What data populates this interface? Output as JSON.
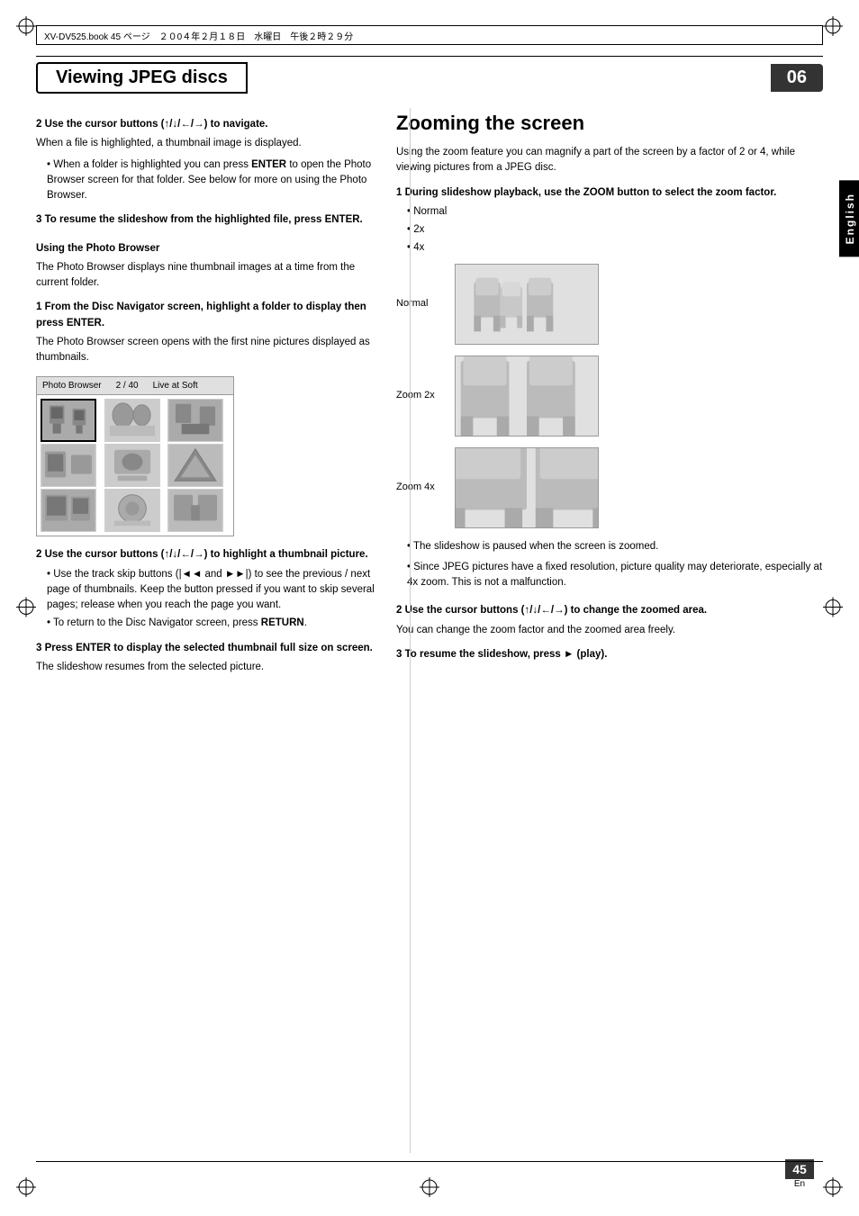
{
  "page": {
    "title": "Viewing JPEG discs",
    "number": "06",
    "bottom_page": "45",
    "bottom_lang": "En",
    "header_japanese": "XV-DV525.book  45 ページ　２０0４年２月１８日　水曜日　午後２時２９分"
  },
  "english_tab": "English",
  "left_column": {
    "step2_nav_heading": "2   Use the cursor buttons (↑/↓/←/→) to navigate.",
    "step2_nav_body": "When a file is highlighted, a thumbnail image is displayed.",
    "step2_nav_bullet1": "When a folder is highlighted you can press ENTER to open the Photo Browser screen for that folder. See below for more on using the Photo Browser.",
    "step3_resume_heading": "3   To resume the slideshow from the highlighted file, press ENTER.",
    "using_photo_browser_heading": "Using the Photo Browser",
    "using_photo_browser_body": "The Photo Browser displays nine thumbnail images at a time from the current folder.",
    "step1_disc_nav_heading": "1   From the Disc Navigator screen, highlight a folder to display then press ENTER.",
    "step1_disc_nav_body": "The Photo Browser screen opens with the first nine pictures displayed as thumbnails.",
    "photo_browser_header_label": "Photo Browser",
    "photo_browser_header_count": "2 / 40",
    "photo_browser_header_mode": "Live at Soft",
    "step2_highlight_heading": "2   Use the cursor buttons (↑/↓/←/→) to highlight a thumbnail picture.",
    "step2_highlight_bullet1": "Use the track skip buttons (|◄◄ and ►►|) to see the previous / next page of thumbnails. Keep the button pressed if you want to skip several pages; release when you reach the page you want.",
    "step2_highlight_bullet2": "To return to the Disc Navigator screen, press RETURN.",
    "step3_press_enter_heading": "3   Press ENTER to display the selected thumbnail full size on screen.",
    "step3_press_enter_body": "The slideshow resumes from the selected picture."
  },
  "right_column": {
    "zooming_heading": "Zooming the screen",
    "zooming_intro": "Using the zoom feature you can magnify a part of the screen by a factor of 2 or 4, while viewing pictures from a JPEG disc.",
    "step1_zoom_heading": "1   During slideshow playback, use the ZOOM button to select the zoom factor.",
    "zoom_bullet_normal": "Normal",
    "zoom_bullet_2x": "2x",
    "zoom_bullet_4x": "4x",
    "zoom_label_normal": "Normal",
    "zoom_label_2x": "Zoom 2x",
    "zoom_label_4x": "Zoom 4x",
    "bullet_paused": "The slideshow is paused when the screen is zoomed.",
    "bullet_quality": "Since JPEG pictures have a fixed resolution, picture quality may deteriorate, especially at 4x zoom. This is not a malfunction.",
    "step2_cursor_heading": "2   Use the cursor buttons (↑/↓/←/→) to change the zoomed area.",
    "step2_cursor_body": "You can change the zoom factor and the zoomed area freely.",
    "step3_resume_heading": "3   To resume the slideshow, press ► (play)."
  }
}
